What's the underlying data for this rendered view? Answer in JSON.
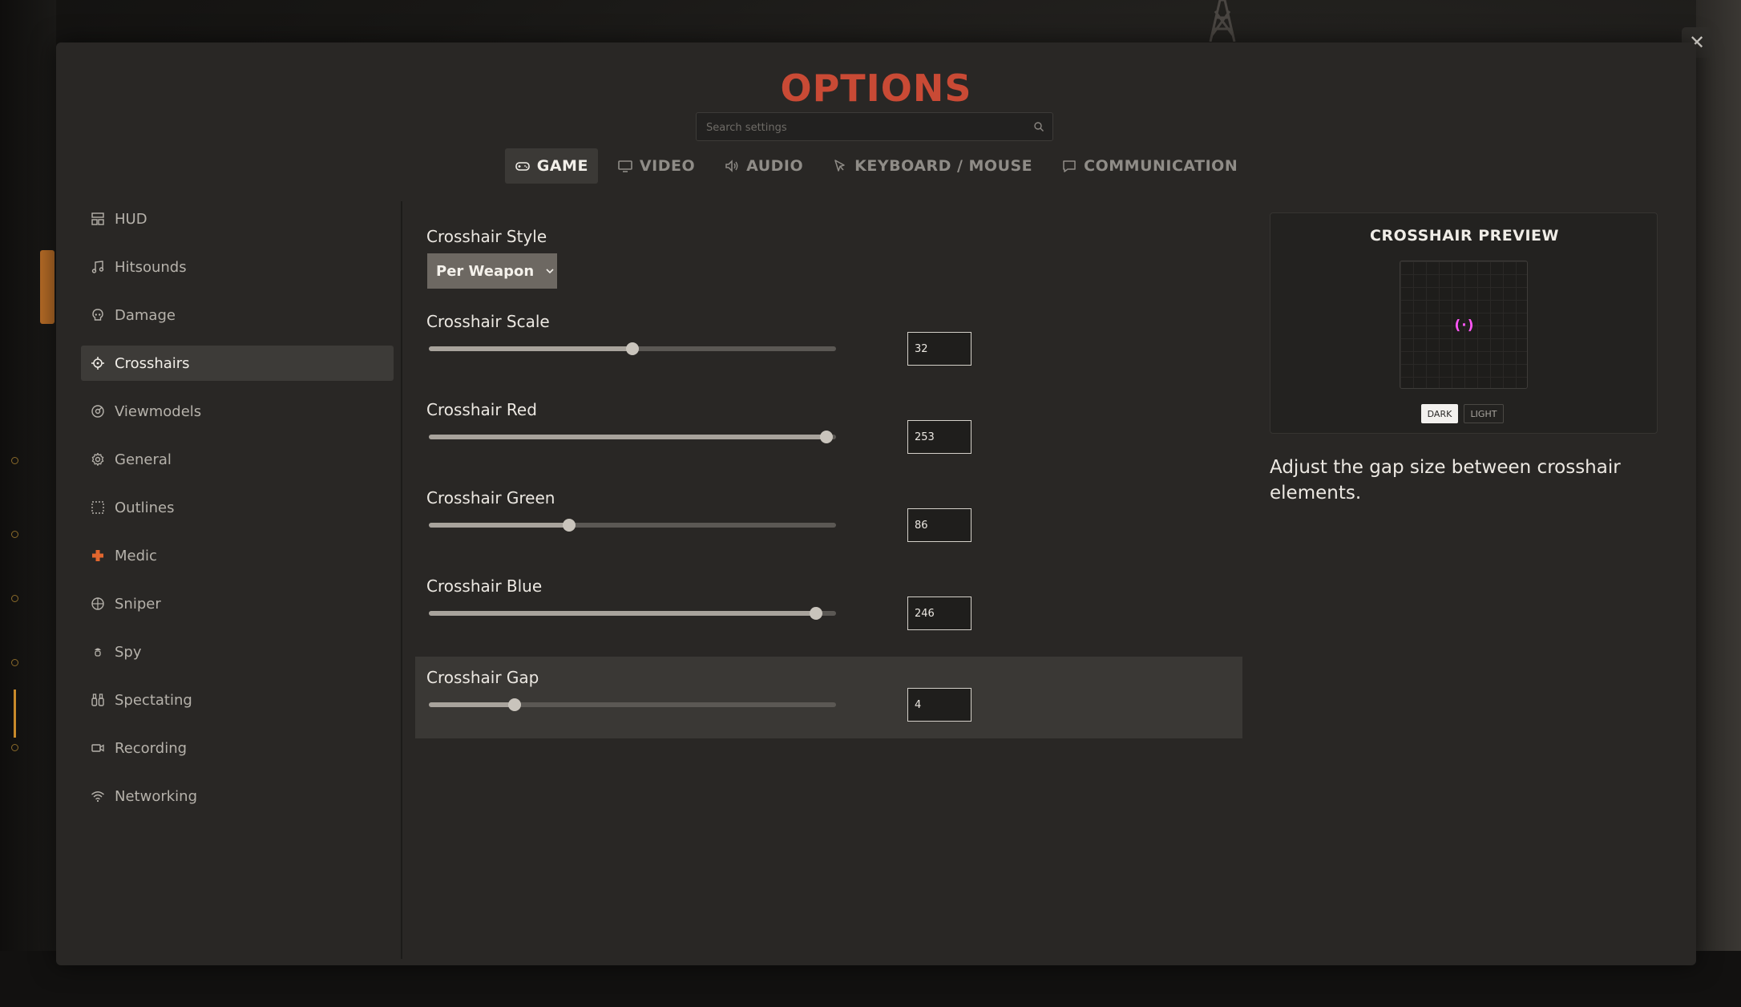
{
  "window": {
    "title": "OPTIONS",
    "close_icon": "close-icon"
  },
  "search": {
    "placeholder": "Search settings",
    "value": ""
  },
  "tabs": [
    {
      "label": "GAME",
      "icon": "gamepad-icon",
      "active": true
    },
    {
      "label": "VIDEO",
      "icon": "monitor-icon",
      "active": false
    },
    {
      "label": "AUDIO",
      "icon": "speaker-icon",
      "active": false
    },
    {
      "label": "KEYBOARD / MOUSE",
      "icon": "cursor-icon",
      "active": false
    },
    {
      "label": "COMMUNICATION",
      "icon": "chat-icon",
      "active": false
    }
  ],
  "sidebar": {
    "items": [
      {
        "label": "HUD",
        "icon": "hud-icon"
      },
      {
        "label": "Hitsounds",
        "icon": "music-note-icon"
      },
      {
        "label": "Damage",
        "icon": "skull-icon"
      },
      {
        "label": "Crosshairs",
        "icon": "crosshair-icon",
        "active": true
      },
      {
        "label": "Viewmodels",
        "icon": "viewmodel-icon"
      },
      {
        "label": "General",
        "icon": "gear-icon"
      },
      {
        "label": "Outlines",
        "icon": "dashed-square-icon"
      },
      {
        "label": "Medic",
        "icon": "medic-cross-icon"
      },
      {
        "label": "Sniper",
        "icon": "scope-icon"
      },
      {
        "label": "Spy",
        "icon": "spy-icon"
      },
      {
        "label": "Spectating",
        "icon": "binoculars-icon"
      },
      {
        "label": "Recording",
        "icon": "video-camera-icon"
      },
      {
        "label": "Networking",
        "icon": "wifi-icon"
      }
    ]
  },
  "settings": {
    "style": {
      "label": "Crosshair Style",
      "value": "Per Weapon"
    },
    "scale": {
      "label": "Crosshair Scale",
      "value": "32",
      "fraction": 0.5
    },
    "red": {
      "label": "Crosshair Red",
      "value": "253",
      "fraction": 0.976
    },
    "green": {
      "label": "Crosshair Green",
      "value": "86",
      "fraction": 0.344
    },
    "blue": {
      "label": "Crosshair Blue",
      "value": "246",
      "fraction": 0.95
    },
    "gap": {
      "label": "Crosshair Gap",
      "value": "4",
      "fraction": 0.21
    }
  },
  "preview": {
    "title": "CROSSHAIR PREVIEW",
    "crosshair_glyph": "(·)",
    "crosshair_color": "#fd56f6",
    "dark_label": "DARK",
    "light_label": "LIGHT",
    "selected_theme": "DARK"
  },
  "description": "Adjust the gap size between crosshair elements.",
  "colors": {
    "title_accent": "#c94a35",
    "modal_bg": "#292725"
  }
}
